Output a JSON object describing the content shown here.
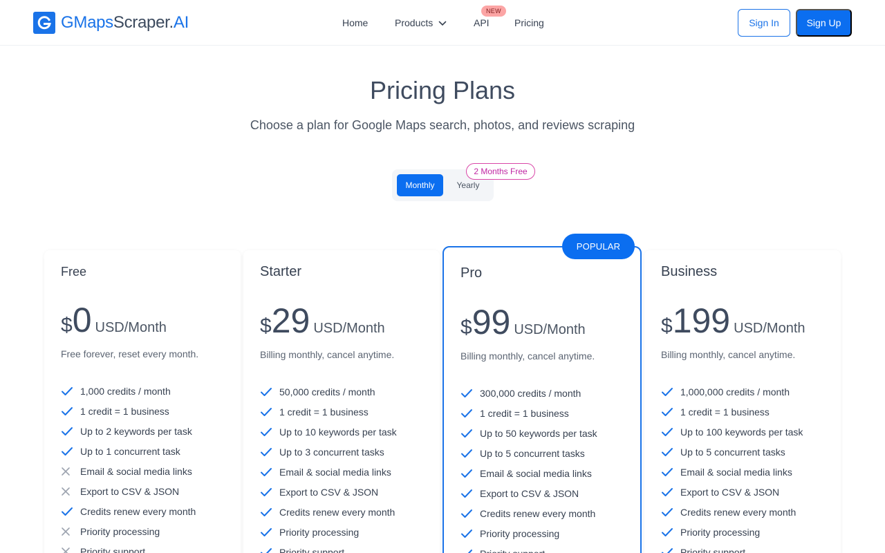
{
  "brand": {
    "g": "G",
    "maps": "Maps",
    "scraper": "Scraper.",
    "ai": "AI"
  },
  "nav": {
    "home": "Home",
    "products": "Products",
    "api": "API",
    "api_badge": "NEW",
    "pricing": "Pricing"
  },
  "auth": {
    "sign_in": "Sign In",
    "sign_up": "Sign Up"
  },
  "hero": {
    "title": "Pricing Plans",
    "subtitle": "Choose a plan for Google Maps search, photos, and reviews scraping"
  },
  "billing_toggle": {
    "monthly": "Monthly",
    "yearly": "Yearly",
    "yearly_badge": "2 Months Free",
    "selected": "Monthly"
  },
  "popular_badge": "POPULAR",
  "colors": {
    "accent": "#0b6ef0",
    "check": "#1a73e8",
    "cross": "#9ca3af",
    "badge_pink": "#c026a3"
  },
  "plans": [
    {
      "name": "Free",
      "currency": "$",
      "price": "0",
      "unit": "USD/Month",
      "note": "Free forever, reset every month.",
      "features": [
        {
          "text": "1,000 credits / month",
          "included": true
        },
        {
          "text": "1 credit = 1 business",
          "included": true
        },
        {
          "text": "Up to 2 keywords per task",
          "included": true
        },
        {
          "text": "Up to 1 concurrent task",
          "included": true
        },
        {
          "text": "Email & social media links",
          "included": false
        },
        {
          "text": "Export to CSV & JSON",
          "included": false
        },
        {
          "text": "Credits renew every month",
          "included": true
        },
        {
          "text": "Priority processing",
          "included": false
        },
        {
          "text": "Priority support",
          "included": false
        }
      ]
    },
    {
      "name": "Starter",
      "currency": "$",
      "price": "29",
      "unit": "USD/Month",
      "note": "Billing monthly, cancel anytime.",
      "features": [
        {
          "text": "50,000 credits / month",
          "included": true
        },
        {
          "text": "1 credit = 1 business",
          "included": true
        },
        {
          "text": "Up to 10 keywords per task",
          "included": true
        },
        {
          "text": "Up to 3 concurrent tasks",
          "included": true
        },
        {
          "text": "Email & social media links",
          "included": true
        },
        {
          "text": "Export to CSV & JSON",
          "included": true
        },
        {
          "text": "Credits renew every month",
          "included": true
        },
        {
          "text": "Priority processing",
          "included": true
        },
        {
          "text": "Priority support",
          "included": true
        }
      ]
    },
    {
      "name": "Pro",
      "currency": "$",
      "price": "99",
      "unit": "USD/Month",
      "note": "Billing monthly, cancel anytime.",
      "features": [
        {
          "text": "300,000 credits / month",
          "included": true
        },
        {
          "text": "1 credit = 1 business",
          "included": true
        },
        {
          "text": "Up to 50 keywords per task",
          "included": true
        },
        {
          "text": "Up to 5 concurrent tasks",
          "included": true
        },
        {
          "text": "Email & social media links",
          "included": true
        },
        {
          "text": "Export to CSV & JSON",
          "included": true
        },
        {
          "text": "Credits renew every month",
          "included": true
        },
        {
          "text": "Priority processing",
          "included": true
        },
        {
          "text": "Priority support",
          "included": true
        }
      ]
    },
    {
      "name": "Business",
      "currency": "$",
      "price": "199",
      "unit": "USD/Month",
      "note": "Billing monthly, cancel anytime.",
      "features": [
        {
          "text": "1,000,000 credits / month",
          "included": true
        },
        {
          "text": "1 credit = 1 business",
          "included": true
        },
        {
          "text": "Up to 100 keywords per task",
          "included": true
        },
        {
          "text": "Up to 5 concurrent tasks",
          "included": true
        },
        {
          "text": "Email & social media links",
          "included": true
        },
        {
          "text": "Export to CSV & JSON",
          "included": true
        },
        {
          "text": "Credits renew every month",
          "included": true
        },
        {
          "text": "Priority processing",
          "included": true
        },
        {
          "text": "Priority support",
          "included": true
        }
      ]
    }
  ]
}
